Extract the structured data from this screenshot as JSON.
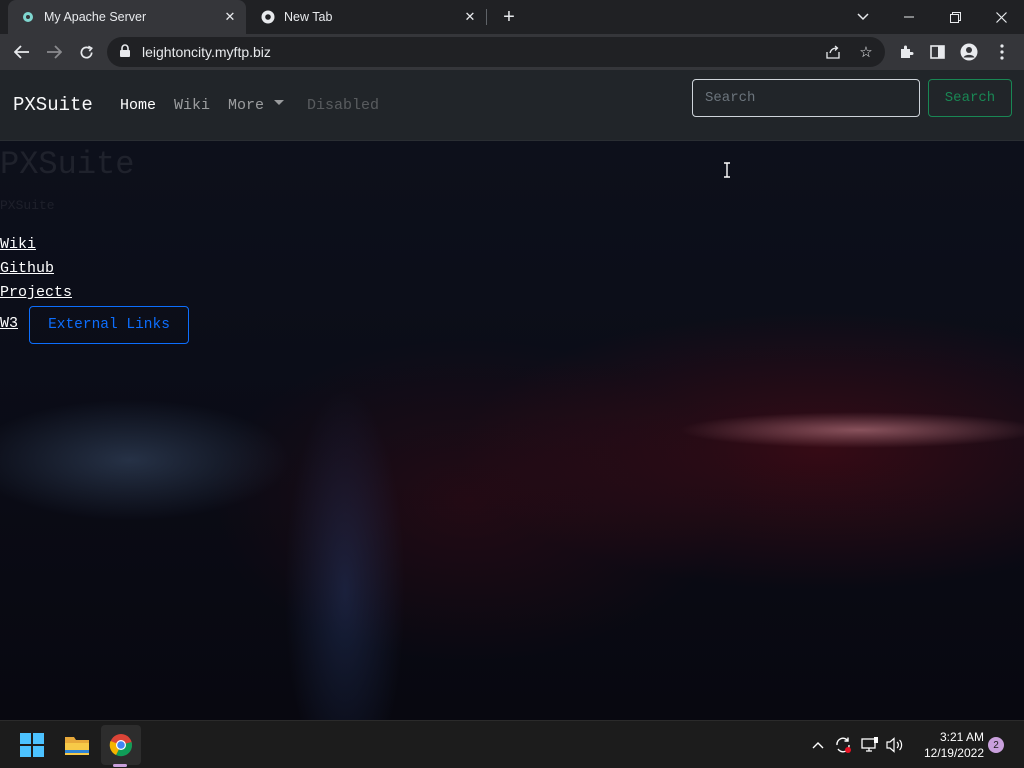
{
  "browser": {
    "tabs": [
      {
        "title": "My Apache Server",
        "active": true,
        "icon": "apache-favicon-icon"
      },
      {
        "title": "New Tab",
        "active": false,
        "icon": "chrome-icon"
      }
    ],
    "url": "leightoncity.myftp.biz"
  },
  "site": {
    "brand": "PXSuite",
    "nav": {
      "home": "Home",
      "wiki": "Wiki",
      "more": "More",
      "disabled": "Disabled"
    },
    "search": {
      "placeholder": "Search",
      "button": "Search"
    },
    "hero_title": "PXSuite",
    "hero_subtitle": "PXSuite",
    "links": [
      "Wiki",
      "Github",
      "Projects",
      "W3"
    ],
    "external_button": "External Links"
  },
  "taskbar": {
    "time": "3:21 AM",
    "date": "12/19/2022",
    "notification_count": "2"
  },
  "colors": {
    "nav_bg": "#212529",
    "success": "#198754",
    "primary": "#0d6efd"
  }
}
